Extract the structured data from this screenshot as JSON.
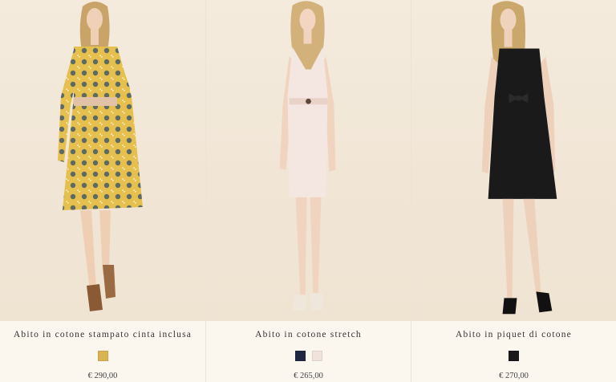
{
  "products": [
    {
      "name": "Abito in cotone stampato cinta inclusa",
      "price": "€ 290,00",
      "swatches": [
        "#d9b452"
      ],
      "image": "model-yellow-print-dress"
    },
    {
      "name": "Abito in cotone stretch",
      "price": "€ 265,00",
      "swatches": [
        "#1f2740",
        "#f1e3dc"
      ],
      "image": "model-pale-pink-sheath-dress"
    },
    {
      "name": "Abito in piquet di cotone",
      "price": "€ 270,00",
      "swatches": [
        "#1a1a1a"
      ],
      "image": "model-black-bow-dress"
    }
  ]
}
